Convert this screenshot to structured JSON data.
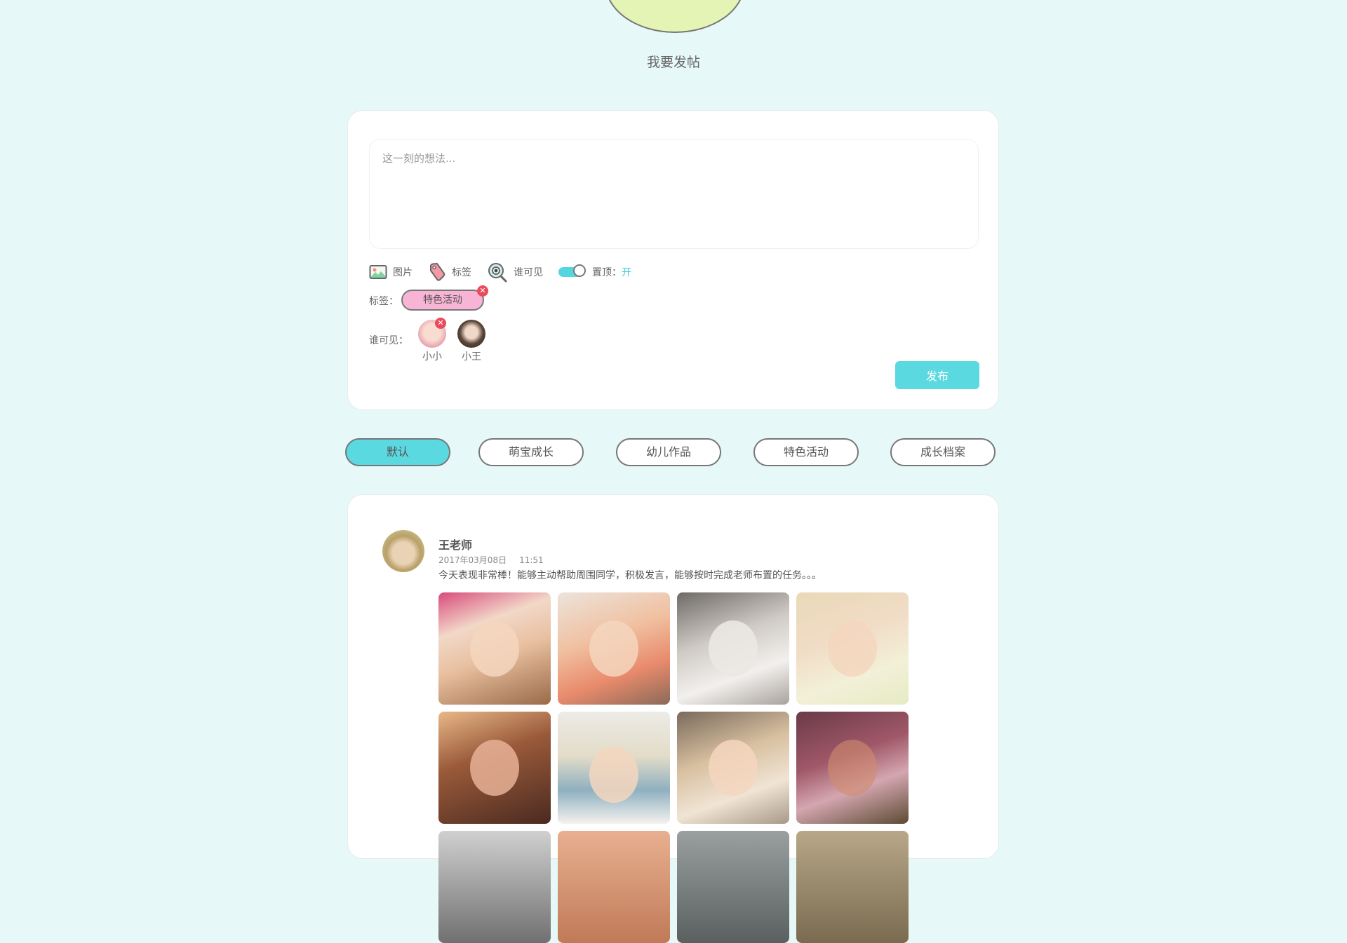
{
  "page": {
    "title": "我要发帖"
  },
  "composer": {
    "placeholder": "这一刻的想法...",
    "toolbar": {
      "image_label": "图片",
      "tag_label": "标签",
      "visibility_label": "谁可见",
      "pin_label": "置顶：",
      "pin_state": "开"
    },
    "tags_row": {
      "label": "标签：",
      "tags": [
        "特色活动"
      ]
    },
    "visible_row": {
      "label": "谁可见：",
      "users": [
        "小小",
        "小王"
      ]
    },
    "publish_label": "发布"
  },
  "filters": {
    "tabs": [
      "默认",
      "萌宝成长",
      "幼儿作品",
      "特色活动",
      "成长档案"
    ],
    "active": "默认"
  },
  "post": {
    "author": "王老师",
    "date": "2017年03月08日",
    "time": "11:51",
    "text": "今天表现非常棒！能够主动帮助周围同学，积极发言，能够按时完成老师布置的任务。。。",
    "photo_count": 12
  },
  "colors": {
    "background": "#e6f8f7",
    "accent": "#5bd9e1",
    "tag_pink": "#f8b4d4",
    "remove_red": "#e94b5a",
    "header_circle": "#e4f4b4"
  },
  "icons": [
    "image-icon",
    "tag-icon",
    "eye-icon",
    "toggle-switch",
    "remove-icon"
  ]
}
